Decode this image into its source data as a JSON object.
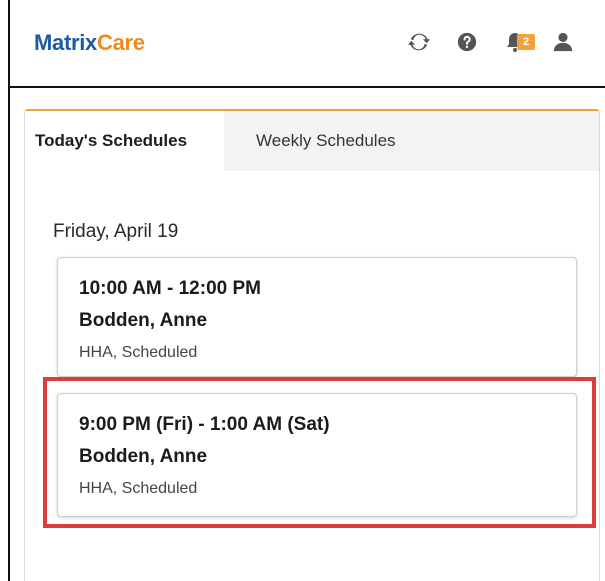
{
  "app": {
    "logo_part1": "Matrix",
    "logo_part2": "Care",
    "notification_count": "2"
  },
  "tabs": [
    {
      "label": "Today's Schedules",
      "active": true
    },
    {
      "label": "Weekly Schedules",
      "active": false
    }
  ],
  "schedule": {
    "date": "Friday, April 19",
    "visits": [
      {
        "time": "10:00 AM - 12:00 PM",
        "name": "Bodden, Anne",
        "status": "HHA, Scheduled"
      },
      {
        "time": "9:00 PM (Fri) - 1:00 AM (Sat)",
        "name": "Bodden, Anne",
        "status": "HHA, Scheduled"
      }
    ]
  },
  "colors": {
    "brand_blue": "#1a5aa8",
    "brand_orange": "#f08a1c",
    "badge": "#f2a23a",
    "highlight": "#e03a3a"
  },
  "icons": [
    "refresh-icon",
    "help-icon",
    "bell-icon",
    "user-icon"
  ]
}
